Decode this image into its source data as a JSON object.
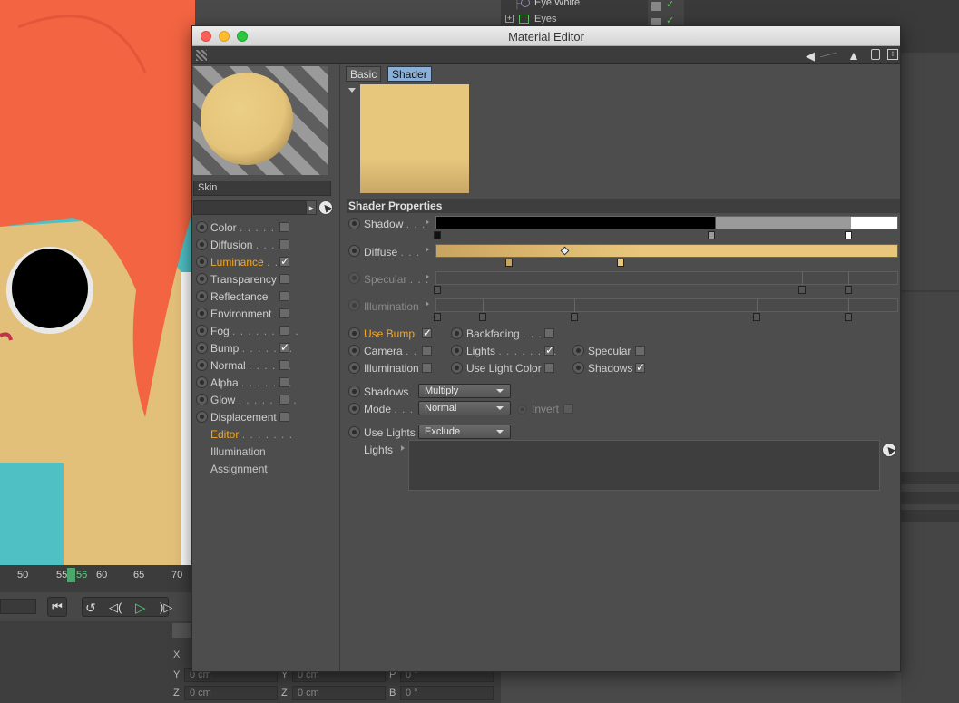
{
  "object_manager": {
    "items": [
      "Eye White",
      "Eyes"
    ]
  },
  "timeline": {
    "ticks": [
      "50",
      "55",
      "56",
      "60",
      "65",
      "70"
    ],
    "current_frame": "56"
  },
  "coordinates": {
    "rows": [
      {
        "axis": "X"
      },
      {
        "axis": "Y",
        "value": "0 cm",
        "axis2": "Y",
        "value2": "0 cm",
        "axis3": "P",
        "value3": "0 °"
      },
      {
        "axis": "Z",
        "value": "0 cm",
        "axis2": "Z",
        "value2": "0 cm",
        "axis3": "B",
        "value3": "0 °"
      }
    ]
  },
  "window": {
    "title": "Material Editor"
  },
  "material": {
    "name": "Skin",
    "channels": [
      {
        "label": "Color",
        "dots": ". . . . . . .",
        "checked": false,
        "active": false
      },
      {
        "label": "Diffusion",
        "dots": ". . . .",
        "checked": false,
        "active": false
      },
      {
        "label": "Luminance",
        "dots": ". . .",
        "checked": true,
        "active": true
      },
      {
        "label": "Transparency",
        "dots": "",
        "checked": false,
        "active": false
      },
      {
        "label": "Reflectance",
        "dots": "",
        "checked": false,
        "active": false
      },
      {
        "label": "Environment",
        "dots": "",
        "checked": false,
        "active": false
      },
      {
        "label": "Fog",
        "dots": ". . . . . . . . .",
        "checked": false,
        "active": false
      },
      {
        "label": "Bump",
        "dots": ". . . . . . .",
        "checked": true,
        "active": false
      },
      {
        "label": "Normal",
        "dots": ". . . . . .",
        "checked": false,
        "active": false
      },
      {
        "label": "Alpha",
        "dots": ". . . . . . .",
        "checked": false,
        "active": false
      },
      {
        "label": "Glow",
        "dots": ". . . . . . . .",
        "checked": false,
        "active": false
      },
      {
        "label": "Displacement",
        "dots": "",
        "checked": false,
        "active": false
      }
    ],
    "extra_items": [
      {
        "label": "Editor",
        "dots": ". . . . . . .",
        "active": true
      },
      {
        "label": "Illumination",
        "dots": "",
        "active": false
      },
      {
        "label": "Assignment",
        "dots": "",
        "active": false
      }
    ]
  },
  "tabs": {
    "basic": "Basic",
    "shader": "Shader"
  },
  "shader_properties": {
    "header": "Shader Properties",
    "shadow_label": "Shadow",
    "diffuse_label": "Diffuse",
    "specular_label": "Specular",
    "illumination_label": "Illumination",
    "dots2": ". . .",
    "dots3": ". . .",
    "dots4": ". . ."
  },
  "options": {
    "use_bump": {
      "label": "Use Bump",
      "checked": true
    },
    "backfacing": {
      "label": "Backfacing",
      "dots": ". . .",
      "checked": false
    },
    "camera": {
      "label": "Camera",
      "dots": ". . .",
      "checked": false
    },
    "lights": {
      "label": "Lights",
      "dots": ". . . . . . . .",
      "checked": true
    },
    "specular": {
      "label": "Specular",
      "checked": false
    },
    "illumination": {
      "label": "Illumination",
      "checked": false
    },
    "use_light_color": {
      "label": "Use Light Color",
      "checked": false
    },
    "shadows_opt": {
      "label": "Shadows",
      "checked": true
    }
  },
  "settings": {
    "shadows_label": "Shadows",
    "shadows_value": "Multiply",
    "mode_label": "Mode",
    "mode_dots": ". . . .",
    "mode_value": "Normal",
    "invert_label": "Invert",
    "use_lights_label": "Use Lights",
    "use_lights_value": "Exclude",
    "lights_label": "Lights"
  },
  "colors": {
    "skin": "#e7c77c",
    "active": "#f5a623",
    "teal": "#4fc0c4",
    "hair": "#f26442"
  }
}
